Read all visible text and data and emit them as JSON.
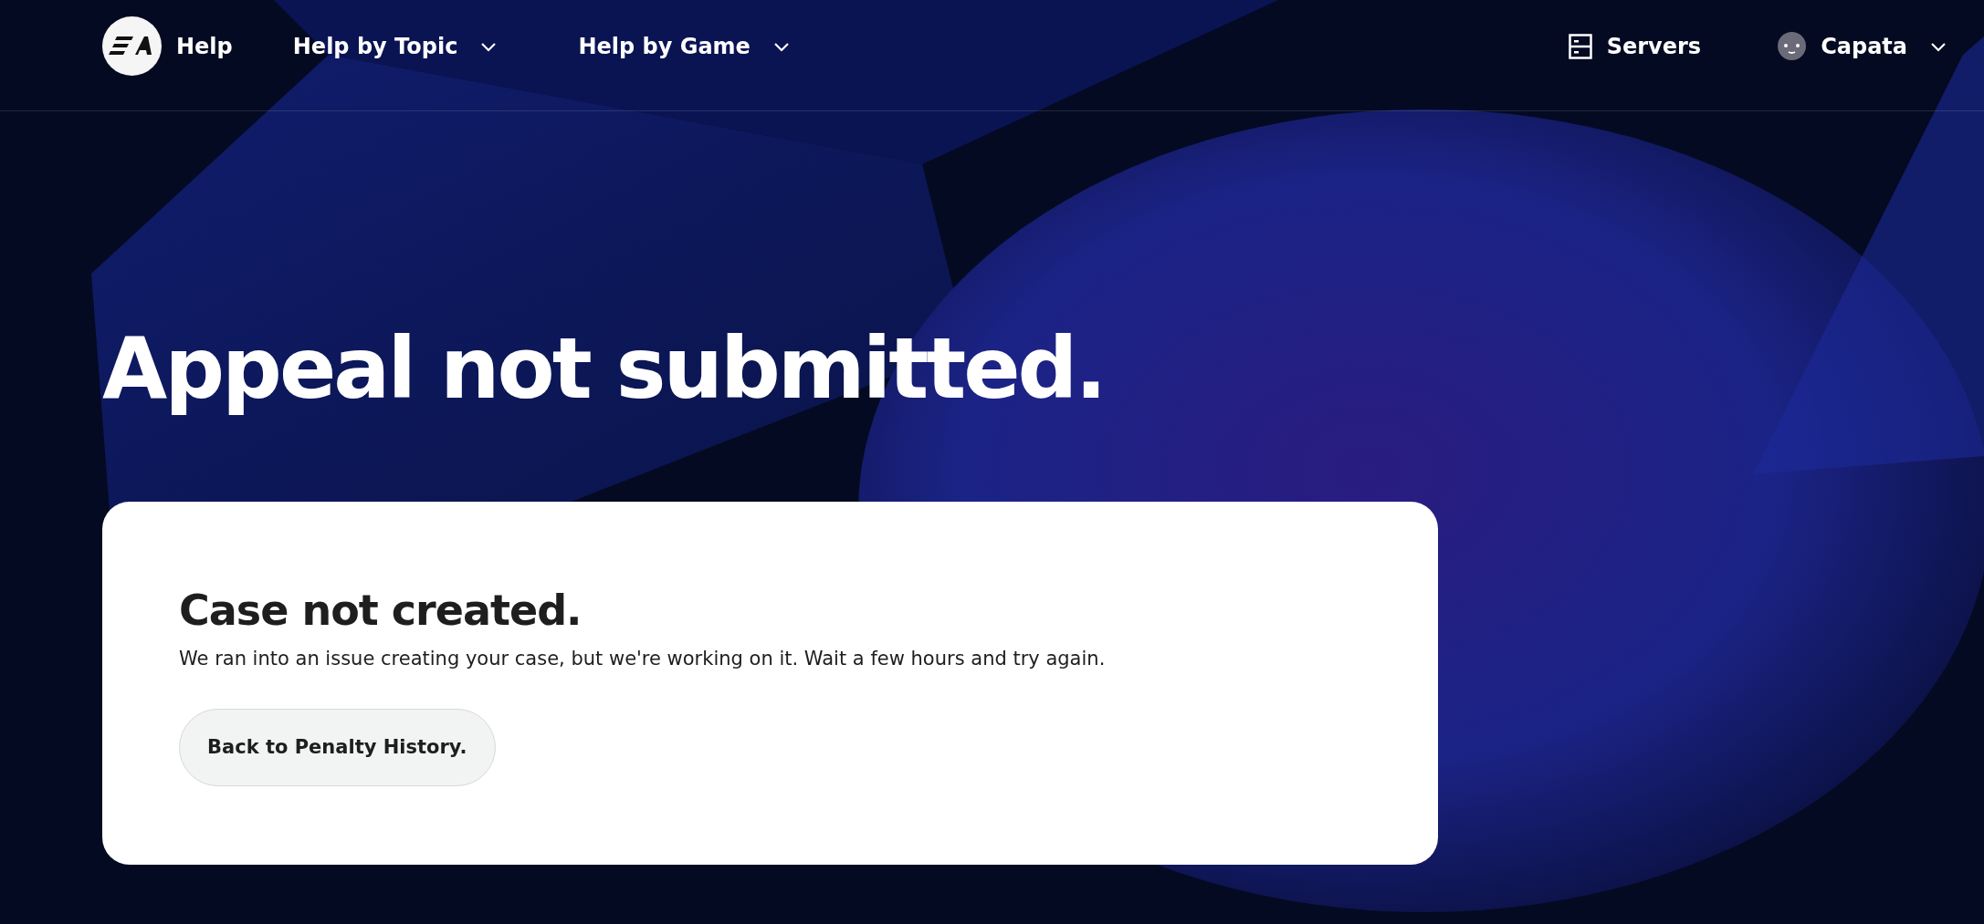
{
  "nav": {
    "brand": "Help",
    "menus": [
      {
        "label": "Help by Topic",
        "expanded": false
      },
      {
        "label": "Help by Game",
        "expanded": false
      }
    ],
    "servers": "Servers",
    "account": {
      "name": "Capata",
      "expanded": false
    }
  },
  "page_title": "Appeal not submitted.",
  "card": {
    "title": "Case not created.",
    "message": "We ran into an issue creating your case, but we're working on it. Wait a few hours and try again.",
    "button": "Back to Penalty History."
  }
}
